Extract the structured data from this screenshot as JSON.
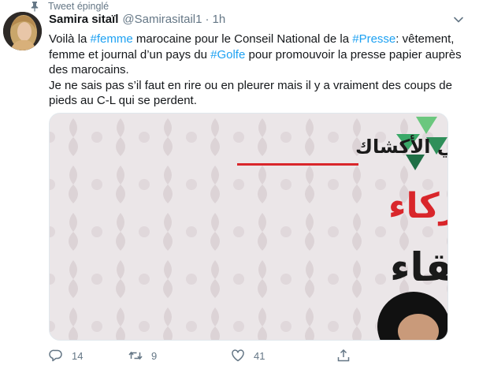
{
  "pinned": {
    "label": "Tweet épinglé"
  },
  "author": {
    "name": "Samira sitaïl",
    "handle": "@Samirasitail1",
    "separator": "·",
    "time": "1h"
  },
  "tweet": {
    "p1_a": "Voilà la ",
    "tag_femme": "#femme",
    "p1_b": " marocaine pour le Conseil National de la ",
    "tag_presse": "#Presse",
    "p1_c": ": vêtement, femme et journal d’un pays du ",
    "tag_golfe": "#Golfe",
    "p1_d": " pour promouvoir la presse papier auprès des marocains.",
    "p2": "Je ne sais pas s’il faut en rire ou en pleurer mais il y a vraiment des coups de pieds au C-L qui se perdent."
  },
  "media": {
    "line1": "رقميا أو في الأكشاك",
    "line2": "بدعمكم كقراء وشركاء",
    "line3": "نستطيع البقاء"
  },
  "actions": {
    "reply_count": "14",
    "retweet_count": "9",
    "like_count": "41"
  },
  "colors": {
    "link": "#1da1f2",
    "secondary": "#657786",
    "headline_red": "#d9262b",
    "accent_green": "#3aa868"
  }
}
